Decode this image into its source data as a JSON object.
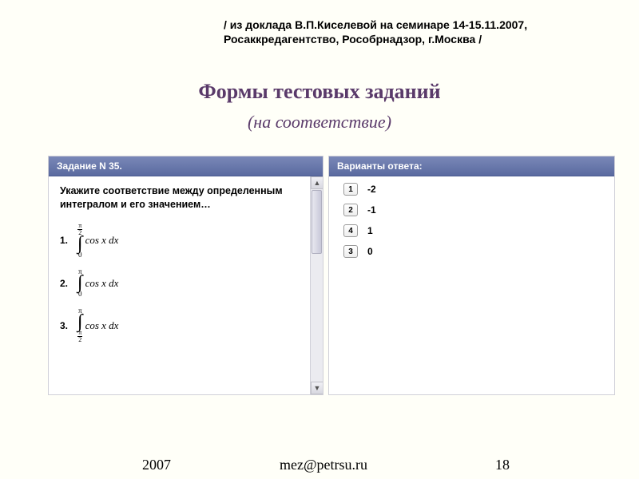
{
  "source_note": "/ из доклада В.П.Киселевой на семинаре 14-15.11.2007, Росаккредагентство, Рособрнадзор, г.Москва /",
  "title": "Формы тестовых заданий",
  "subtitle": "(на соответствие)",
  "left_panel": {
    "header": "Задание N 35.",
    "prompt": "Укажите соответствие между определенным интегралом и его значением…",
    "items": [
      {
        "num": "1.",
        "upper_is_frac": true,
        "upper_num": "π",
        "upper_den": "2",
        "lower": "0",
        "body": "cos x dx"
      },
      {
        "num": "2.",
        "upper_is_frac": false,
        "upper": "π",
        "lower": "0",
        "body": "cos x dx"
      },
      {
        "num": "3.",
        "upper_is_frac": false,
        "upper": "π",
        "lower_is_frac": true,
        "lower_num": "π",
        "lower_den": "2",
        "body": "cos x dx"
      }
    ]
  },
  "right_panel": {
    "header": "Варианты ответа:",
    "answers": [
      {
        "box": "1",
        "value": "-2"
      },
      {
        "box": "2",
        "value": "-1"
      },
      {
        "box": "4",
        "value": "1"
      },
      {
        "box": "3",
        "value": "0"
      }
    ]
  },
  "footer": {
    "year": "2007",
    "email": "mez@petrsu.ru",
    "page": "18"
  }
}
